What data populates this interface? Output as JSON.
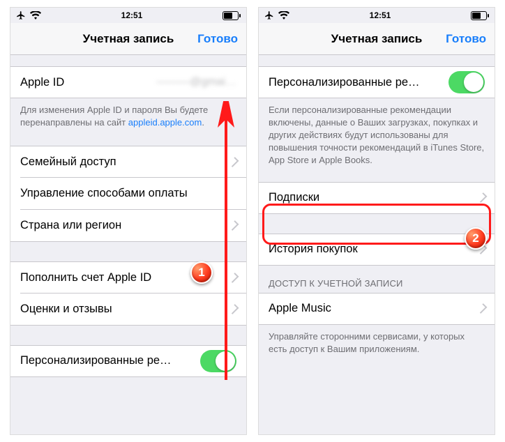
{
  "statusbar": {
    "time": "12:51"
  },
  "navbar": {
    "title": "Учетная запись",
    "done": "Готово"
  },
  "left": {
    "apple_id_label": "Apple ID",
    "apple_id_value": "———@gmai…",
    "footer_id_1": "Для изменения Apple ID и пароля Вы будете перенаправлены на сайт ",
    "footer_id_link": "appleid.apple.com",
    "family": "Семейный доступ",
    "payment": "Управление способами оплаты",
    "region": "Страна или регион",
    "topup": "Пополнить счет Apple ID",
    "ratings": "Оценки и отзывы",
    "personalized": "Персонализированные ре…"
  },
  "right": {
    "personalized": "Персонализированные ре…",
    "footer_pers": "Если персонализированные рекомендации включены, данные о Ваших загрузках, покупках и других действиях будут использованы для повышения точности рекомендаций в iTunes Store, App Store и Apple Books.",
    "subs": "Подписки",
    "history": "История покупок",
    "access_header": "ДОСТУП К УЧЕТНОЙ ЗАПИСИ",
    "apple_music": "Apple Music",
    "footer_access": "Управляйте сторонними сервисами, у которых есть доступ к Вашим приложениям."
  },
  "badges": {
    "b1": "1",
    "b2": "2"
  }
}
